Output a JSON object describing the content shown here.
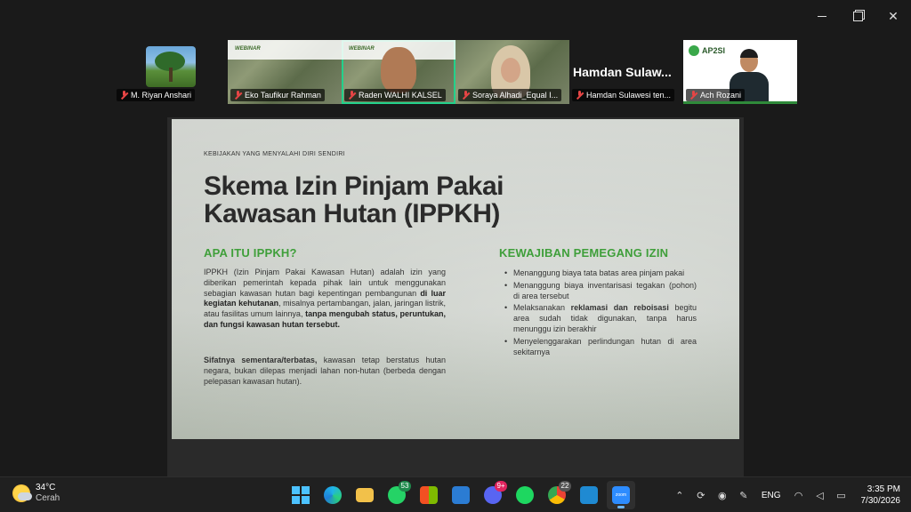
{
  "window": {
    "min_icon": "minimize-icon",
    "max_icon": "restore-icon",
    "close_icon": "close-icon"
  },
  "participants": [
    {
      "name": "M. Riyan Anshari",
      "muted": true
    },
    {
      "name": "Eko Taufikur Rahman",
      "muted": true,
      "banner": "WEBINAR"
    },
    {
      "name": "Raden WALHI KALSEL",
      "muted": true,
      "banner": "WEBINAR",
      "active": true
    },
    {
      "name": "Soraya Alhadi_Equal I...",
      "muted": true
    },
    {
      "name": "Hamdan Sulawesi ten...",
      "muted": true,
      "big_name": "Hamdan  Sulaw..."
    },
    {
      "name": "Ach Rozani",
      "muted": true,
      "logo": "AP2SI"
    }
  ],
  "slide": {
    "kicker": "KEBIJAKAN YANG MENYALAHI DIRI SENDIRI",
    "title_line1": "Skema Izin Pinjam Pakai",
    "title_line2": "Kawasan Hutan (IPPKH)",
    "left_heading": "APA ITU IPPKH?",
    "left_p1_a": "IPPKH (Izin Pinjam Pakai Kawasan Hutan) adalah izin yang diberikan pemerintah kepada pihak lain untuk menggunakan sebagian kawasan hutan bagi kepentingan pembangunan ",
    "left_p1_b": "di luar kegiatan kehutanan",
    "left_p1_c": ", misalnya pertambangan, jalan, jaringan listrik, atau fasilitas umum lainnya, ",
    "left_p1_d": "tanpa mengubah status, peruntukan, dan fungsi kawasan hutan tersebut.",
    "left_p2_a": "Sifatnya sementara/terbatas,",
    "left_p2_b": " kawasan tetap berstatus hutan negara, bukan dilepas menjadi lahan non-hutan (berbeda dengan pelepasan kawasan hutan).",
    "right_heading": "KEWAJIBAN PEMEGANG IZIN",
    "right_items": [
      {
        "text": "Menanggung biaya tata batas area pinjam pakai"
      },
      {
        "text": "Menanggung biaya inventarisasi tegakan (pohon) di area tersebut"
      },
      {
        "pre": "Melaksanakan ",
        "bold": "reklamasi dan reboisasi",
        "post": " begitu area sudah tidak digunakan, tanpa harus menunggu izin berakhir"
      },
      {
        "text": "Menyelenggarakan perlindungan hutan di area sekitarnya"
      }
    ]
  },
  "taskbar": {
    "weather_temp": "34°C",
    "weather_cond": "Cerah",
    "whatsapp_badge": "53",
    "discord_badge": "9+",
    "chrome_badge": "22",
    "zoom_label": "zoom",
    "lang": "ENG",
    "time": "3:35 PM",
    "date": "7/30/2026"
  }
}
